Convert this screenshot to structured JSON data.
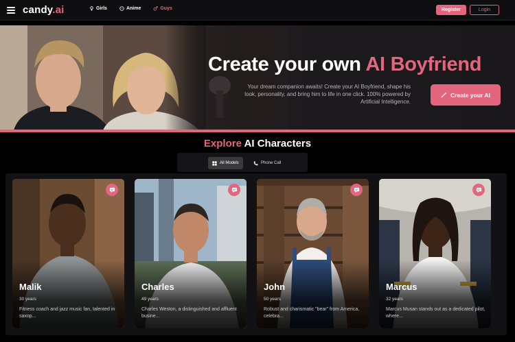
{
  "nav": {
    "logo_main": "candy",
    "logo_suffix": ".ai",
    "links": [
      {
        "label": "Girls",
        "icon": "female-icon"
      },
      {
        "label": "Anime",
        "icon": "anime-icon"
      },
      {
        "label": "Guys",
        "icon": "male-icon"
      }
    ],
    "register_label": "Register",
    "login_label": "Login"
  },
  "hero": {
    "title_plain": "Create your own ",
    "title_accent": "AI Boyfriend",
    "description": "Your dream companion awaits! Create your AI Boyfriend, shape his look, personality, and bring him to life in one click. 100% powered by Artificial Intelligence.",
    "cta_label": "Create your AI"
  },
  "explore": {
    "title_accent": "Explore",
    "title_plain": " AI Characters",
    "tabs": [
      {
        "label": "All Models",
        "icon": "grid-icon",
        "active": true
      },
      {
        "label": "Phone Call",
        "icon": "phone-icon",
        "active": false
      }
    ]
  },
  "characters": [
    {
      "name": "Malik",
      "age": "30 years",
      "description": "Fitness coach and jazz music fan, talented in saxop..."
    },
    {
      "name": "Charles",
      "age": "49 years",
      "description": "Charles Weston, a distinguished and affluent busine..."
    },
    {
      "name": "John",
      "age": "50 years",
      "description": "Robust and charismatic \"bear\" from America, celebra..."
    },
    {
      "name": "Marcus",
      "age": "32 years",
      "description": "Marcus Musan stands out as a dedicated pilot, where..."
    }
  ],
  "colors": {
    "accent": "#e4667e",
    "background": "#000000",
    "nav": "#0e0e10"
  }
}
